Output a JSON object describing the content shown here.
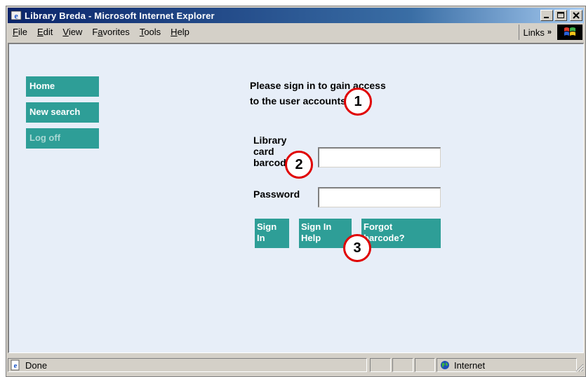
{
  "window": {
    "title": "Library Breda - Microsoft Internet Explorer"
  },
  "menu": {
    "items": [
      {
        "label": "File",
        "accel": "F",
        "rest": "ile"
      },
      {
        "label": "Edit",
        "accel": "E",
        "rest": "dit"
      },
      {
        "label": "View",
        "accel": "V",
        "rest": "iew"
      },
      {
        "label": "Favorites",
        "accel": "a",
        "pre": "F",
        "rest": "vorites"
      },
      {
        "label": "Tools",
        "accel": "T",
        "rest": "ools"
      },
      {
        "label": "Help",
        "accel": "H",
        "rest": "elp"
      }
    ],
    "links_label": "Links",
    "links_chevron": "»"
  },
  "nav": {
    "home": "Home",
    "new_search": "New search",
    "log_off": "Log off"
  },
  "form": {
    "prompt_line1": "Please sign in to gain access",
    "prompt_line2": "to the user accounts",
    "barcode_label_1": "Library",
    "barcode_label_2": "card",
    "barcode_label_3": "barcode",
    "barcode_value": "",
    "password_label": "Password",
    "password_value": ""
  },
  "buttons": {
    "sign_in_1": "Sign",
    "sign_in_2": "In",
    "help_1": "Sign In",
    "help_2": "Help",
    "forgot_1": "Forgot",
    "forgot_2": "barcode?"
  },
  "callouts": [
    "1",
    "2",
    "3"
  ],
  "status": {
    "text": "Done",
    "zone": "Internet"
  },
  "colors": {
    "title_gradient_start": "#0a246a",
    "nav_teal": "#2e9e97",
    "content_bg": "#e7eef8",
    "callout_red": "#e00000",
    "chrome": "#d4d0c8"
  },
  "icons": {
    "title": "ie-logo-icon",
    "throbber": "windows-logo-icon",
    "status": "ie-page-icon",
    "zone": "globe-icon"
  }
}
